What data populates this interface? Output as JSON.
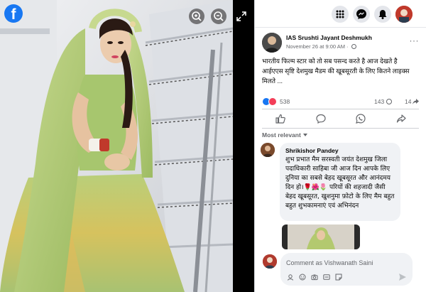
{
  "viewer": {
    "logo_letter": "f",
    "icons": [
      "facebook-logo",
      "zoom-in-icon",
      "zoom-out-icon",
      "expand-icon"
    ]
  },
  "topbar": {
    "icons": [
      "menu-grid-icon",
      "messenger-icon",
      "notifications-bell-icon",
      "profile-avatar"
    ]
  },
  "post": {
    "author": "IAS Srushti Jayant Deshmukh",
    "timestamp": "November 26 at 9:00 AM",
    "meta_separator": " · ",
    "more_label": "···",
    "text": "भारतीय फिल्म स्टार को तो सब पसन्द करते है आज देखते है आईएएस सृष्टि देशमुख मैडम की खूबसूरती के लिए कितने लाइक्स मिलते ...",
    "reaction_count": "538",
    "comment_count": "143",
    "share_count": "14"
  },
  "sort": {
    "label": "Most relevant"
  },
  "comment": {
    "author": "Shrikishor Pandey",
    "text": "शुभ प्रभात मैम सरस्वती जयंत देशमुख जिला पदाधिकारी साहिबा जी आज दिन आपके लिए दुनिया का सबसे बेहद खूबसूरत और आनंदमय दिन हो।🌹🌺🌷 परियों की शहजादी जैसी बेहद खूबसूरत, खुशनुमा फ़ोटो के लिए मैम बहुत बहुत शुभकामनाएं एवं अभिनंदन"
  },
  "composer": {
    "placeholder": "Comment as Vishwanath Saini"
  },
  "colors": {
    "brand": "#1877f2",
    "love": "#f33e58",
    "bubble": "#f0f2f5",
    "secondary_text": "#65676b"
  }
}
